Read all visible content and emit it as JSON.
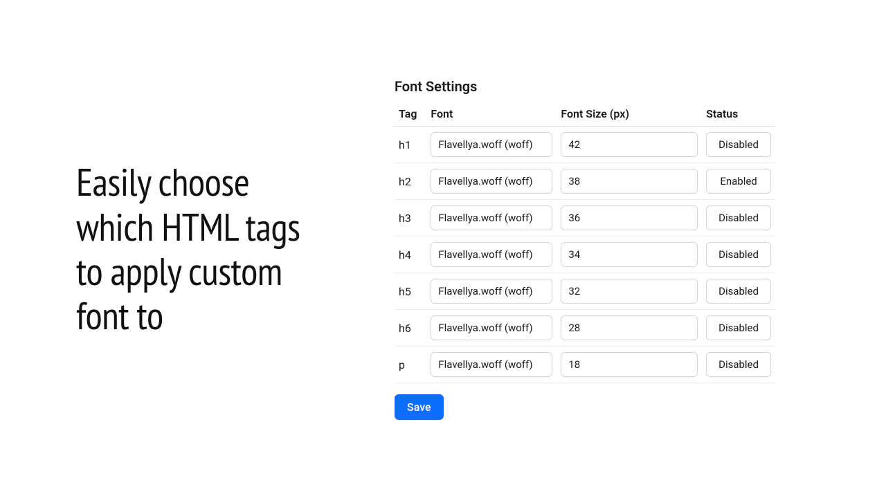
{
  "headline": "Easily choose which HTML tags to apply custom font to",
  "panel": {
    "title": "Font Settings",
    "columns": {
      "tag": "Tag",
      "font": "Font",
      "size": "Font Size (px)",
      "status": "Status"
    },
    "rows": [
      {
        "tag": "h1",
        "font": "Flavellya.woff (woff)",
        "size": "42",
        "status": "Disabled"
      },
      {
        "tag": "h2",
        "font": "Flavellya.woff (woff)",
        "size": "38",
        "status": "Enabled"
      },
      {
        "tag": "h3",
        "font": "Flavellya.woff (woff)",
        "size": "36",
        "status": "Disabled"
      },
      {
        "tag": "h4",
        "font": "Flavellya.woff (woff)",
        "size": "34",
        "status": "Disabled"
      },
      {
        "tag": "h5",
        "font": "Flavellya.woff (woff)",
        "size": "32",
        "status": "Disabled"
      },
      {
        "tag": "h6",
        "font": "Flavellya.woff (woff)",
        "size": "28",
        "status": "Disabled"
      },
      {
        "tag": "p",
        "font": "Flavellya.woff (woff)",
        "size": "18",
        "status": "Disabled"
      }
    ],
    "save_label": "Save"
  }
}
